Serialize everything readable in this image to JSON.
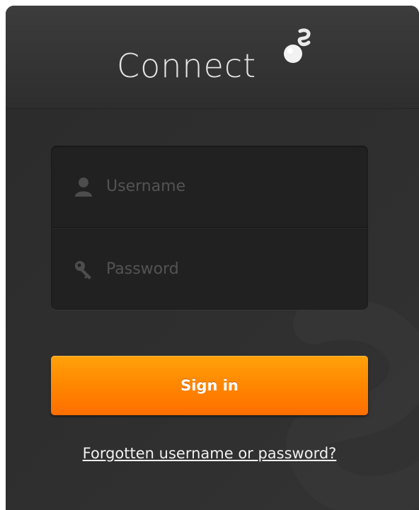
{
  "header": {
    "brand_name": "Connect",
    "logo_icon": "connect-logo-icon"
  },
  "form": {
    "username": {
      "placeholder": "Username",
      "value": "",
      "icon": "user-icon"
    },
    "password": {
      "placeholder": "Password",
      "value": "",
      "icon": "key-icon"
    },
    "signin_label": "Sign in",
    "forgot_label": "Forgotten username or password?"
  },
  "colors": {
    "panel_background": "#2f2f2f",
    "input_box_background": "#212121",
    "button_gradient_top": "#ffa20a",
    "button_gradient_bottom": "#ff6e00",
    "brand_text": "#e4e4e4",
    "link_text": "#f0f0f0"
  }
}
